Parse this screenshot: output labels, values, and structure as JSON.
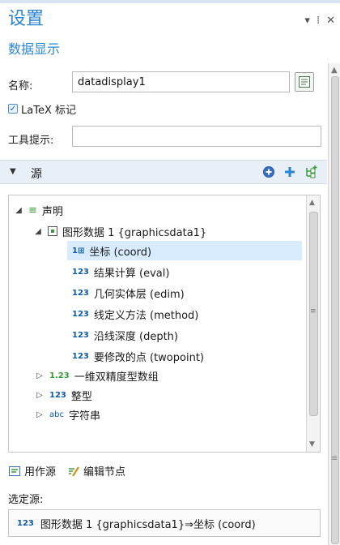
{
  "panel": {
    "title": "设置",
    "subtitle": "数据显示",
    "controls": [
      "▾",
      "⁞",
      "✕"
    ]
  },
  "form": {
    "name_label": "名称:",
    "name_value": "datadisplay1",
    "latex_label": "LaTeX 标记",
    "latex_checked": true,
    "tooltip_label": "工具提示:",
    "tooltip_value": ""
  },
  "section": {
    "title": "源",
    "expanded": true,
    "actions": [
      "add-circle",
      "add",
      "tree-add"
    ]
  },
  "tree": {
    "root": "声明",
    "graphics_node": "图形数据 1 {graphicsdata1}",
    "items": [
      {
        "icon": "1⊞",
        "label": "坐标 (coord)",
        "selected": true
      },
      {
        "icon": "123",
        "label": "结果计算 (eval)",
        "selected": false
      },
      {
        "icon": "123",
        "label": "几何实体层 (edim)",
        "selected": false
      },
      {
        "icon": "123",
        "label": "线定义方法 (method)",
        "selected": false
      },
      {
        "icon": "123",
        "label": "沿线深度 (depth)",
        "selected": false
      },
      {
        "icon": "123",
        "label": "要修改的点 (twopoint)",
        "selected": false
      }
    ],
    "groups": [
      {
        "icon": "1.23",
        "label": "一维双精度型数组"
      },
      {
        "icon": "123",
        "label": "整型"
      },
      {
        "icon": "abc",
        "label": "字符串"
      }
    ]
  },
  "actions": {
    "use_as_source": "用作源",
    "edit_node": "编辑节点"
  },
  "selected_source": {
    "label": "选定源:",
    "icon": "123",
    "value": "图形数据 1 {graphicsdata1}⇒坐标 (coord)"
  },
  "colors": {
    "accent": "#2a86d1",
    "selected_row": "#d8ebff",
    "section_bar": "#e9eff7",
    "add_green": "#3a9a3a"
  }
}
